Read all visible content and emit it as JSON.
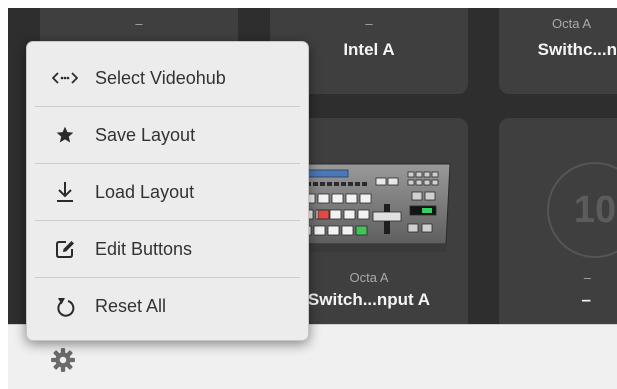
{
  "tiles": [
    {
      "sub": "–",
      "main": ""
    },
    {
      "sub": "–",
      "main": "Intel A"
    },
    {
      "sub": "Octa A",
      "main": "Swithc...n"
    },
    {
      "sub": "Octa A",
      "main": "Switch...nput A"
    },
    {
      "sub": "–",
      "main": "–",
      "counter": "10"
    }
  ],
  "menu": {
    "items": [
      {
        "label": "Select Videohub",
        "icon": "code-arrows-icon"
      },
      {
        "label": "Save Layout",
        "icon": "star-icon"
      },
      {
        "label": "Load Layout",
        "icon": "download-icon"
      },
      {
        "label": "Edit Buttons",
        "icon": "edit-icon"
      },
      {
        "label": "Reset All",
        "icon": "reset-icon"
      }
    ]
  },
  "toolbar": {
    "settings_icon": "gear-icon"
  },
  "colors": {
    "menu_bg": "#ececec",
    "panel_bg": "#2e2e2e",
    "tile_bg": "#3f3f3f",
    "highlight_red": "#e24a4a",
    "highlight_green": "#3ec45a"
  }
}
